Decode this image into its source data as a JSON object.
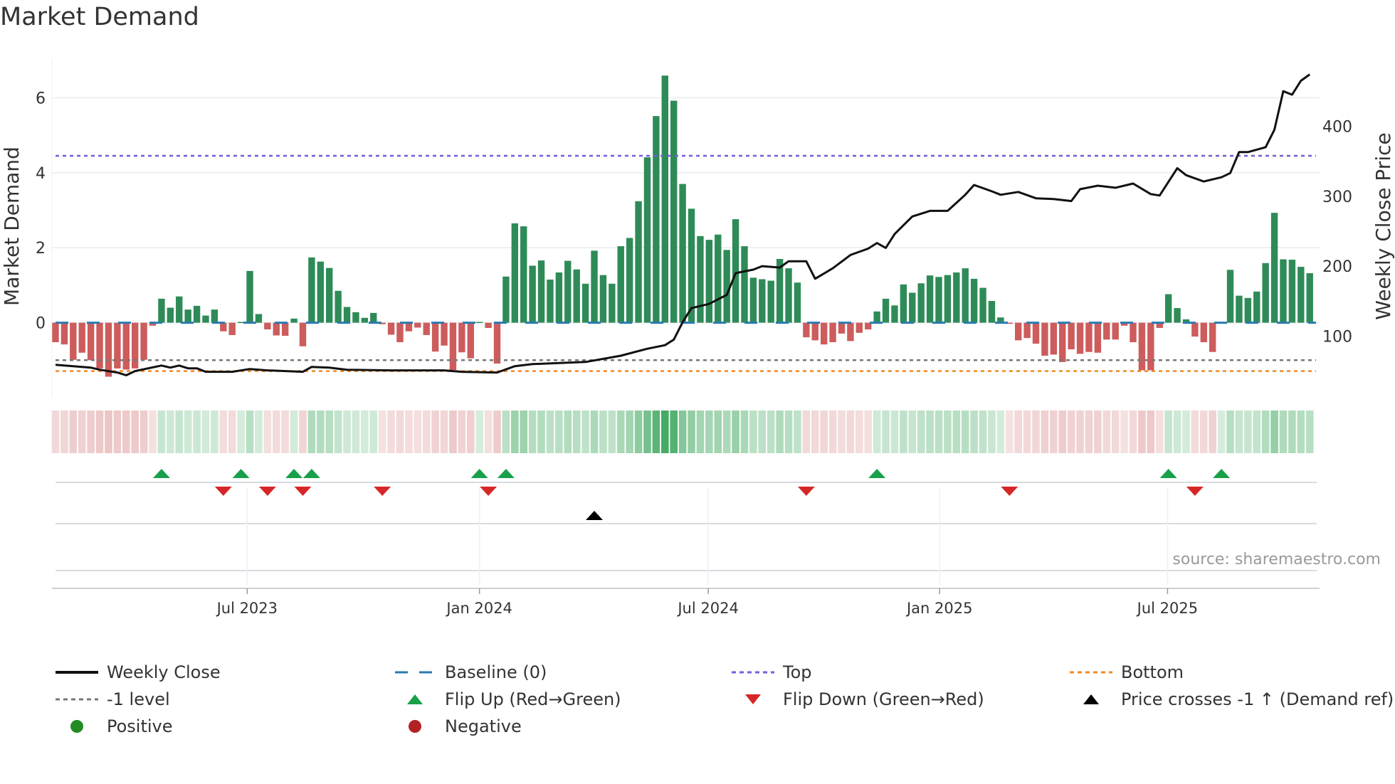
{
  "chart_data": {
    "type": "bar",
    "title": "Market Demand",
    "ylabel": "Market Demand",
    "y2label": "Weekly Close Price",
    "ylim": [
      -2.0,
      7.05
    ],
    "y2lim": [
      12,
      497
    ],
    "yticks": [
      0,
      2,
      4,
      6
    ],
    "y2ticks": [
      100,
      200,
      300,
      400
    ],
    "x_ticks": [
      {
        "label": "Jul 2023",
        "week": 21.7
      },
      {
        "label": "Jan 2024",
        "week": 48.0
      },
      {
        "label": "Jul 2024",
        "week": 73.9
      },
      {
        "label": "Jan 2025",
        "week": 100.1
      },
      {
        "label": "Jul 2025",
        "week": 125.9
      }
    ],
    "demand": [
      -0.52,
      -0.58,
      -0.99,
      -0.8,
      -1.0,
      -1.22,
      -1.44,
      -1.22,
      -1.25,
      -1.22,
      -0.99,
      -0.08,
      0.64,
      0.4,
      0.7,
      0.35,
      0.45,
      0.19,
      0.35,
      -0.23,
      -0.33,
      0.02,
      1.38,
      0.23,
      -0.18,
      -0.34,
      -0.35,
      0.11,
      -0.63,
      1.74,
      1.63,
      1.46,
      0.85,
      0.42,
      0.28,
      0.13,
      0.26,
      -0.04,
      -0.32,
      -0.52,
      -0.23,
      -0.13,
      -0.33,
      -0.77,
      -0.61,
      -1.26,
      -0.79,
      -0.95,
      0.02,
      -0.14,
      -1.09,
      1.23,
      2.65,
      2.57,
      1.52,
      1.66,
      1.15,
      1.34,
      1.65,
      1.42,
      1.04,
      1.92,
      1.27,
      1.04,
      2.04,
      2.26,
      3.24,
      4.41,
      5.51,
      6.59,
      5.92,
      3.7,
      3.04,
      2.31,
      2.21,
      2.35,
      1.94,
      2.76,
      2.04,
      1.2,
      1.16,
      1.12,
      1.7,
      1.45,
      1.07,
      -0.39,
      -0.47,
      -0.58,
      -0.52,
      -0.29,
      -0.49,
      -0.27,
      -0.18,
      0.3,
      0.64,
      0.46,
      1.02,
      0.8,
      1.05,
      1.26,
      1.22,
      1.27,
      1.34,
      1.45,
      1.17,
      0.93,
      0.58,
      0.14,
      -0.03,
      -0.47,
      -0.41,
      -0.56,
      -0.88,
      -0.85,
      -1.05,
      -0.71,
      -0.83,
      -0.78,
      -0.8,
      -0.45,
      -0.45,
      -0.08,
      -0.52,
      -1.27,
      -1.27,
      -0.14,
      0.76,
      0.39,
      0.09,
      -0.37,
      -0.52,
      -0.78,
      0.01,
      1.41,
      0.72,
      0.66,
      0.83,
      1.59,
      2.93,
      1.69,
      1.68,
      1.49,
      1.32
    ],
    "weekly_close_points": [
      [
        0,
        59
      ],
      [
        2,
        57
      ],
      [
        4,
        55
      ],
      [
        5,
        52
      ],
      [
        7,
        48
      ],
      [
        8,
        44
      ],
      [
        9,
        50
      ],
      [
        12,
        58
      ],
      [
        13,
        55
      ],
      [
        14,
        58
      ],
      [
        15,
        54
      ],
      [
        16,
        54
      ],
      [
        17,
        49
      ],
      [
        20,
        49
      ],
      [
        22,
        53
      ],
      [
        24,
        51
      ],
      [
        28,
        49
      ],
      [
        29,
        56
      ],
      [
        31,
        55
      ],
      [
        33,
        52
      ],
      [
        38,
        51
      ],
      [
        44,
        51
      ],
      [
        46,
        49
      ],
      [
        50,
        48
      ],
      [
        52,
        57
      ],
      [
        54,
        60
      ],
      [
        60,
        63
      ],
      [
        64,
        72
      ],
      [
        67,
        82
      ],
      [
        69,
        87
      ],
      [
        70,
        95
      ],
      [
        71,
        120
      ],
      [
        72,
        140
      ],
      [
        74,
        146
      ],
      [
        76,
        159
      ],
      [
        77,
        190
      ],
      [
        79,
        195
      ],
      [
        80,
        200
      ],
      [
        82,
        198
      ],
      [
        83,
        207
      ],
      [
        85,
        207
      ],
      [
        86,
        182
      ],
      [
        88,
        197
      ],
      [
        90,
        216
      ],
      [
        92,
        225
      ],
      [
        93,
        233
      ],
      [
        94,
        226
      ],
      [
        95,
        246
      ],
      [
        97,
        271
      ],
      [
        99,
        279
      ],
      [
        101,
        279
      ],
      [
        103,
        302
      ],
      [
        104,
        316
      ],
      [
        106,
        307
      ],
      [
        107,
        302
      ],
      [
        109,
        306
      ],
      [
        111,
        297
      ],
      [
        113,
        296
      ],
      [
        115,
        293
      ],
      [
        116,
        310
      ],
      [
        118,
        315
      ],
      [
        120,
        312
      ],
      [
        122,
        318
      ],
      [
        124,
        303
      ],
      [
        125,
        301
      ],
      [
        127,
        340
      ],
      [
        128,
        330
      ],
      [
        130,
        321
      ],
      [
        132,
        327
      ],
      [
        133,
        333
      ],
      [
        134,
        363
      ],
      [
        135,
        363
      ],
      [
        137,
        370
      ],
      [
        138,
        395
      ],
      [
        139,
        450
      ],
      [
        140,
        445
      ],
      [
        141,
        465
      ],
      [
        142,
        474
      ]
    ],
    "levels": {
      "top": 4.45,
      "minus_one": -1.0,
      "bottom": -1.29,
      "baseline": 0
    },
    "flip_up_weeks": [
      12,
      21,
      27,
      29,
      48,
      51,
      93,
      126,
      132
    ],
    "flip_down_weeks": [
      19,
      24,
      28,
      37,
      49,
      85,
      108,
      129
    ],
    "price_cross_weeks": [
      61
    ],
    "legend_position": "bottom"
  },
  "colors": {
    "positive_bar": "#2e8b57",
    "negative_bar": "#cd5c5c",
    "price": "#111111",
    "baseline": "#2a7ab0",
    "top": "#7060d8",
    "minus_one": "#777777",
    "bottom": "#f08a24",
    "flip_up": "#18a04a",
    "flip_down": "#d62728",
    "cross": "#000000",
    "positive_dot": "#228b22",
    "negative_dot": "#b22222"
  },
  "legend": {
    "weekly_close": "Weekly Close",
    "baseline": "Baseline (0)",
    "top": "Top",
    "bottom": "Bottom",
    "minus_one": "-1 level",
    "flip_up": "Flip Up (Red→Green)",
    "flip_down": "Flip Down (Green→Red)",
    "price_cross": "Price crosses -1 ↑ (Demand ref)",
    "positive": "Positive",
    "negative": "Negative"
  },
  "source": "source: sharemaestro.com"
}
